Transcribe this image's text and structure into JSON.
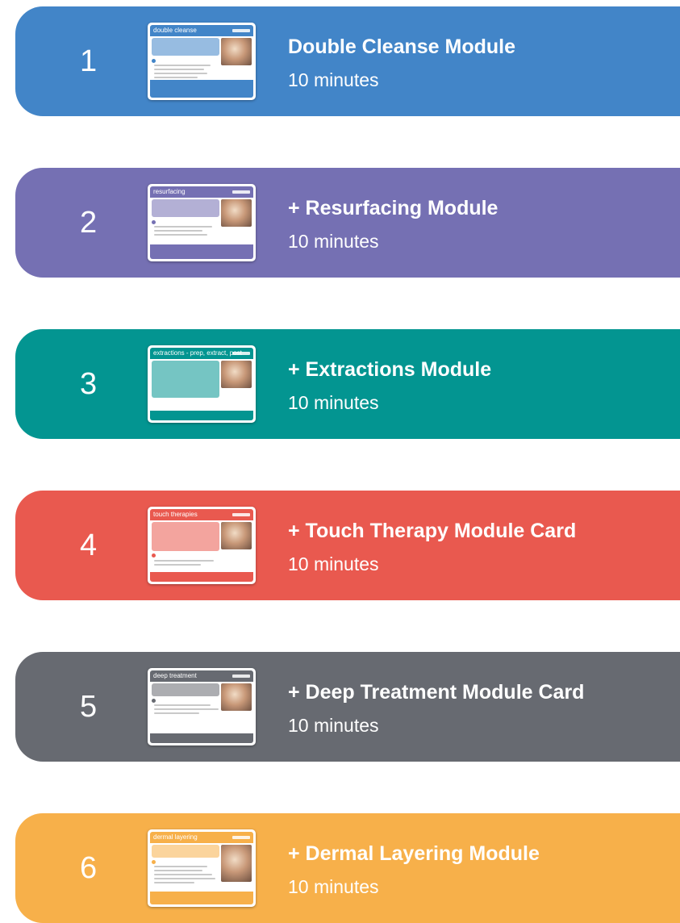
{
  "modules": [
    {
      "number": "1",
      "title": "Double Cleanse Module",
      "duration": "10 minutes",
      "card_title": "double cleanse",
      "color": "#4285c8"
    },
    {
      "number": "2",
      "title": "+ Resurfacing Module",
      "duration": "10 minutes",
      "card_title": "resurfacing",
      "color": "#7570b3"
    },
    {
      "number": "3",
      "title": "+ Extractions Module",
      "duration": "10 minutes",
      "card_title": "extractions - prep, extract, post",
      "color": "#039591"
    },
    {
      "number": "4",
      "title": "+ Touch Therapy Module Card",
      "duration": "10 minutes",
      "card_title": "touch therapies",
      "color": "#e9594f"
    },
    {
      "number": "5",
      "title": "+ Deep Treatment Module Card",
      "duration": "10 minutes",
      "card_title": "deep treatment",
      "color": "#676a71"
    },
    {
      "number": "6",
      "title": "+ Dermal Layering Module",
      "duration": "10 minutes",
      "card_title": "dermal layering",
      "color": "#f7b04a"
    }
  ]
}
